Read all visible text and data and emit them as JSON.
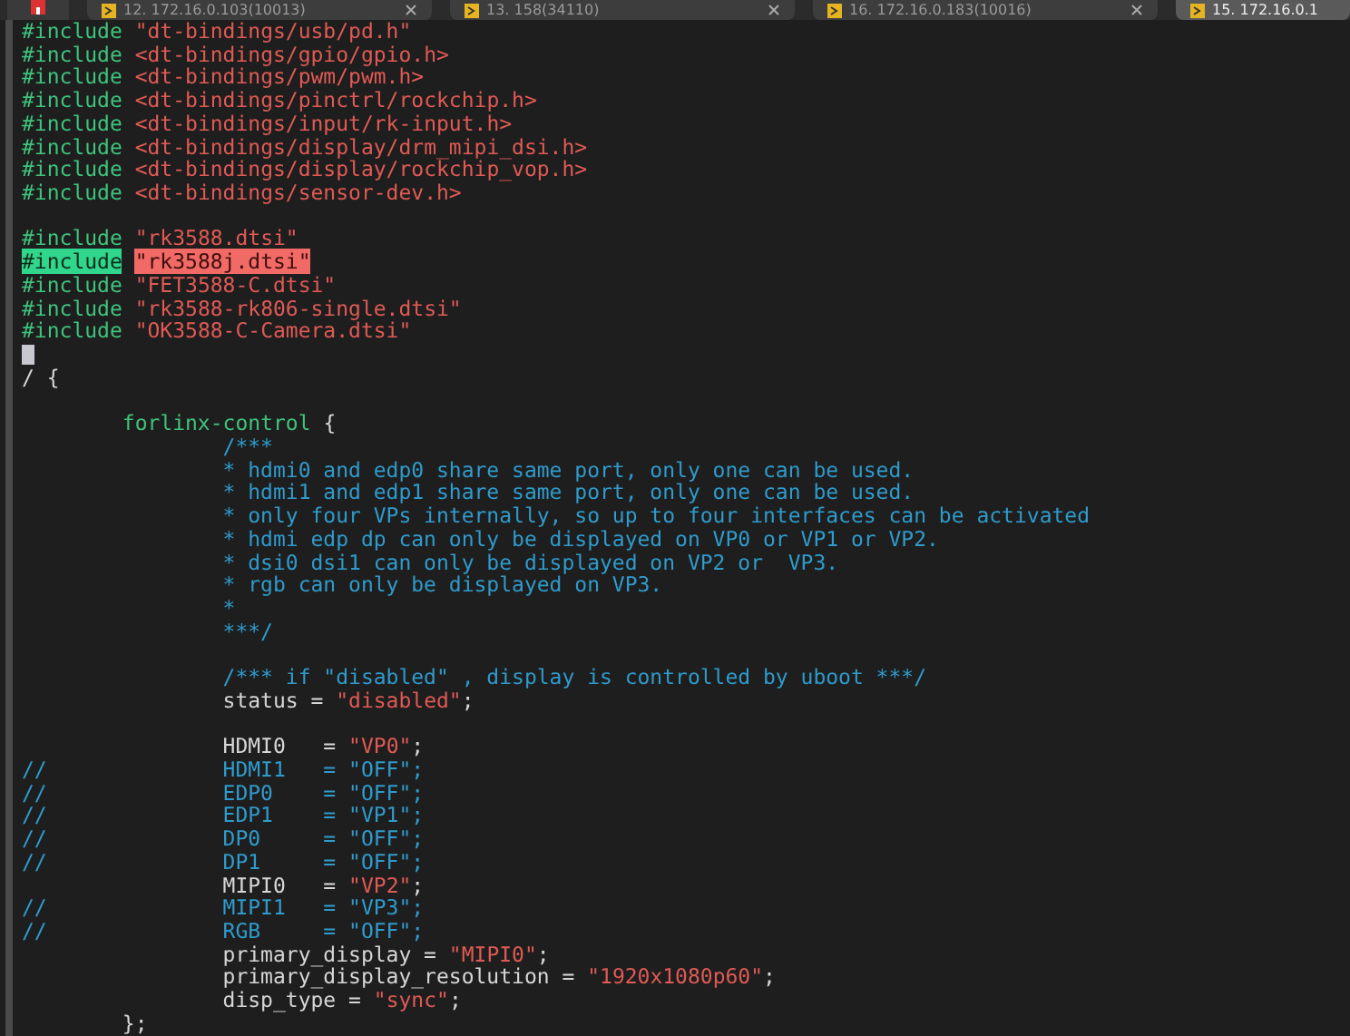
{
  "tabs": [
    {
      "label": "12. 172.16.0.103(10013)",
      "selected": false
    },
    {
      "label": "13. 158(34110)",
      "selected": false
    },
    {
      "label": "16. 172.16.0.183(10016)",
      "selected": false
    },
    {
      "label": "15. 172.16.0.1",
      "selected": true
    }
  ],
  "editor": {
    "lines": [
      {
        "kind": "code",
        "segments": [
          {
            "kind": "pre",
            "text": "#include"
          },
          {
            "kind": "str",
            "text": "\"dt-bindings/usb/pd.h\""
          }
        ]
      },
      {
        "kind": "code",
        "segments": [
          {
            "kind": "pre",
            "text": "#include"
          },
          {
            "kind": "str",
            "text": "<dt-bindings/gpio/gpio.h>"
          }
        ]
      },
      {
        "kind": "code",
        "segments": [
          {
            "kind": "pre",
            "text": "#include"
          },
          {
            "kind": "str",
            "text": "<dt-bindings/pwm/pwm.h>"
          }
        ]
      },
      {
        "kind": "code",
        "segments": [
          {
            "kind": "pre",
            "text": "#include"
          },
          {
            "kind": "str",
            "text": "<dt-bindings/pinctrl/rockchip.h>"
          }
        ]
      },
      {
        "kind": "code",
        "segments": [
          {
            "kind": "pre",
            "text": "#include"
          },
          {
            "kind": "str",
            "text": "<dt-bindings/input/rk-input.h>"
          }
        ]
      },
      {
        "kind": "code",
        "segments": [
          {
            "kind": "pre",
            "text": "#include"
          },
          {
            "kind": "str",
            "text": "<dt-bindings/display/drm_mipi_dsi.h>"
          }
        ]
      },
      {
        "kind": "code",
        "segments": [
          {
            "kind": "pre",
            "text": "#include"
          },
          {
            "kind": "str",
            "text": "<dt-bindings/display/rockchip_vop.h>"
          }
        ]
      },
      {
        "kind": "code",
        "segments": [
          {
            "kind": "pre",
            "text": "#include"
          },
          {
            "kind": "str",
            "text": "<dt-bindings/sensor-dev.h>"
          }
        ]
      },
      {
        "kind": "blank"
      },
      {
        "kind": "code",
        "segments": [
          {
            "kind": "pre",
            "text": "#include"
          },
          {
            "kind": "str",
            "text": "\"rk3588.dtsi\""
          }
        ]
      },
      {
        "kind": "code",
        "segments": [
          {
            "kind": "pre-hl",
            "text": "#include"
          },
          {
            "kind": "str-hl",
            "text": "\"rk3588j.dtsi\""
          }
        ]
      },
      {
        "kind": "code",
        "segments": [
          {
            "kind": "pre",
            "text": "#include"
          },
          {
            "kind": "str",
            "text": "\"FET3588-C.dtsi\""
          }
        ]
      },
      {
        "kind": "code",
        "segments": [
          {
            "kind": "pre",
            "text": "#include"
          },
          {
            "kind": "str",
            "text": "\"rk3588-rk806-single.dtsi\""
          }
        ]
      },
      {
        "kind": "code",
        "segments": [
          {
            "kind": "pre",
            "text": "#include"
          },
          {
            "kind": "str",
            "text": "\"OK3588-C-Camera.dtsi\""
          }
        ]
      },
      {
        "kind": "cursor"
      },
      {
        "kind": "code",
        "segments": [
          {
            "kind": "plain",
            "text": "/ {"
          }
        ]
      },
      {
        "kind": "blank"
      },
      {
        "kind": "code",
        "segments": [
          {
            "kind": "name",
            "text": "\tforlinx-control"
          },
          {
            "kind": "plain",
            "text": "{"
          }
        ]
      },
      {
        "kind": "code",
        "segments": [
          {
            "kind": "comment",
            "text": "\t\t/***"
          }
        ]
      },
      {
        "kind": "code",
        "segments": [
          {
            "kind": "comment",
            "text": "\t\t* hdmi0 and edp0 share same port, only one can be used."
          }
        ]
      },
      {
        "kind": "code",
        "segments": [
          {
            "kind": "comment",
            "text": "\t\t* hdmi1 and edp1 share same port, only one can be used."
          }
        ]
      },
      {
        "kind": "code",
        "segments": [
          {
            "kind": "comment",
            "text": "\t\t* only four VPs internally, so up to four interfaces can be activated"
          }
        ]
      },
      {
        "kind": "code",
        "segments": [
          {
            "kind": "comment",
            "text": "\t\t* hdmi edp dp can only be displayed on VP0 or VP1 or VP2."
          }
        ]
      },
      {
        "kind": "code",
        "segments": [
          {
            "kind": "comment",
            "text": "\t\t* dsi0 dsi1 can only be displayed on VP2 or  VP3."
          }
        ]
      },
      {
        "kind": "code",
        "segments": [
          {
            "kind": "comment",
            "text": "\t\t* rgb can only be displayed on VP3."
          }
        ]
      },
      {
        "kind": "code",
        "segments": [
          {
            "kind": "comment",
            "text": "\t\t*"
          }
        ]
      },
      {
        "kind": "code",
        "segments": [
          {
            "kind": "comment",
            "text": "\t\t***/"
          }
        ]
      },
      {
        "kind": "blank"
      },
      {
        "kind": "code",
        "segments": [
          {
            "kind": "comment",
            "text": "\t\t/*** if \"disabled\" , display is controlled by uboot ***/"
          }
        ]
      },
      {
        "kind": "code",
        "segments": [
          {
            "kind": "plain",
            "text": "\t\tstatus ="
          },
          {
            "kind": "str",
            "text": "\"disabled\""
          },
          {
            "kind": "plain",
            "text": ";"
          }
        ]
      },
      {
        "kind": "blank"
      },
      {
        "kind": "code",
        "segments": [
          {
            "kind": "plain",
            "text": "\t\tHDMI0\t="
          },
          {
            "kind": "str",
            "text": "\"VP0\""
          },
          {
            "kind": "plain",
            "text": ";"
          }
        ]
      },
      {
        "kind": "code",
        "segments": [
          {
            "kind": "comment",
            "text": "//\t\tHDMI1\t= \"OFF\";"
          }
        ]
      },
      {
        "kind": "code",
        "segments": [
          {
            "kind": "comment",
            "text": "//\t\tEDP0\t= \"OFF\";"
          }
        ]
      },
      {
        "kind": "code",
        "segments": [
          {
            "kind": "comment",
            "text": "//\t\tEDP1\t= \"VP1\";"
          }
        ]
      },
      {
        "kind": "code",
        "segments": [
          {
            "kind": "comment",
            "text": "//\t\tDP0\t= \"OFF\";"
          }
        ]
      },
      {
        "kind": "code",
        "segments": [
          {
            "kind": "comment",
            "text": "//\t\tDP1\t= \"OFF\";"
          }
        ]
      },
      {
        "kind": "code",
        "segments": [
          {
            "kind": "plain",
            "text": "\t\tMIPI0\t="
          },
          {
            "kind": "str",
            "text": "\"VP2\""
          },
          {
            "kind": "plain",
            "text": ";"
          }
        ]
      },
      {
        "kind": "code",
        "segments": [
          {
            "kind": "comment",
            "text": "//\t\tMIPI1\t= \"VP3\";"
          }
        ]
      },
      {
        "kind": "code",
        "segments": [
          {
            "kind": "comment",
            "text": "//\t\tRGB\t= \"OFF\";"
          }
        ]
      },
      {
        "kind": "code",
        "segments": [
          {
            "kind": "plain",
            "text": "\t\tprimary_display ="
          },
          {
            "kind": "str",
            "text": "\"MIPI0\""
          },
          {
            "kind": "plain",
            "text": ";"
          }
        ]
      },
      {
        "kind": "code",
        "segments": [
          {
            "kind": "plain",
            "text": "\t\tprimary_display_resolution ="
          },
          {
            "kind": "str",
            "text": "\"1920x1080p60\""
          },
          {
            "kind": "plain",
            "text": ";"
          }
        ]
      },
      {
        "kind": "code",
        "segments": [
          {
            "kind": "plain",
            "text": "\t\tdisp_type ="
          },
          {
            "kind": "str",
            "text": "\"sync\""
          },
          {
            "kind": "plain",
            "text": ";"
          }
        ]
      },
      {
        "kind": "code",
        "segments": [
          {
            "kind": "plain",
            "text": "\t};"
          }
        ]
      }
    ]
  }
}
